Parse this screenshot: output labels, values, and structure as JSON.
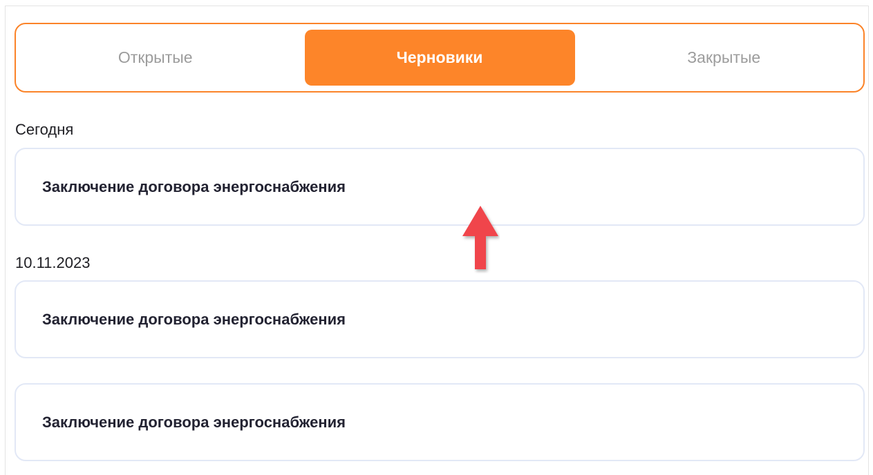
{
  "tabs": [
    {
      "label": "Открытые",
      "active": false
    },
    {
      "label": "Черновики",
      "active": true
    },
    {
      "label": "Закрытые",
      "active": false
    }
  ],
  "groups": [
    {
      "date_label": "Сегодня",
      "items": [
        {
          "title": "Заключение договора энергоснабжения"
        }
      ]
    },
    {
      "date_label": "10.11.2023",
      "items": [
        {
          "title": "Заключение договора энергоснабжения"
        },
        {
          "title": "Заключение договора энергоснабжения"
        }
      ]
    }
  ],
  "colors": {
    "accent": "#fd8529",
    "annotation_arrow": "#f0444b"
  },
  "annotation": {
    "icon": "red-up-arrow-icon"
  }
}
